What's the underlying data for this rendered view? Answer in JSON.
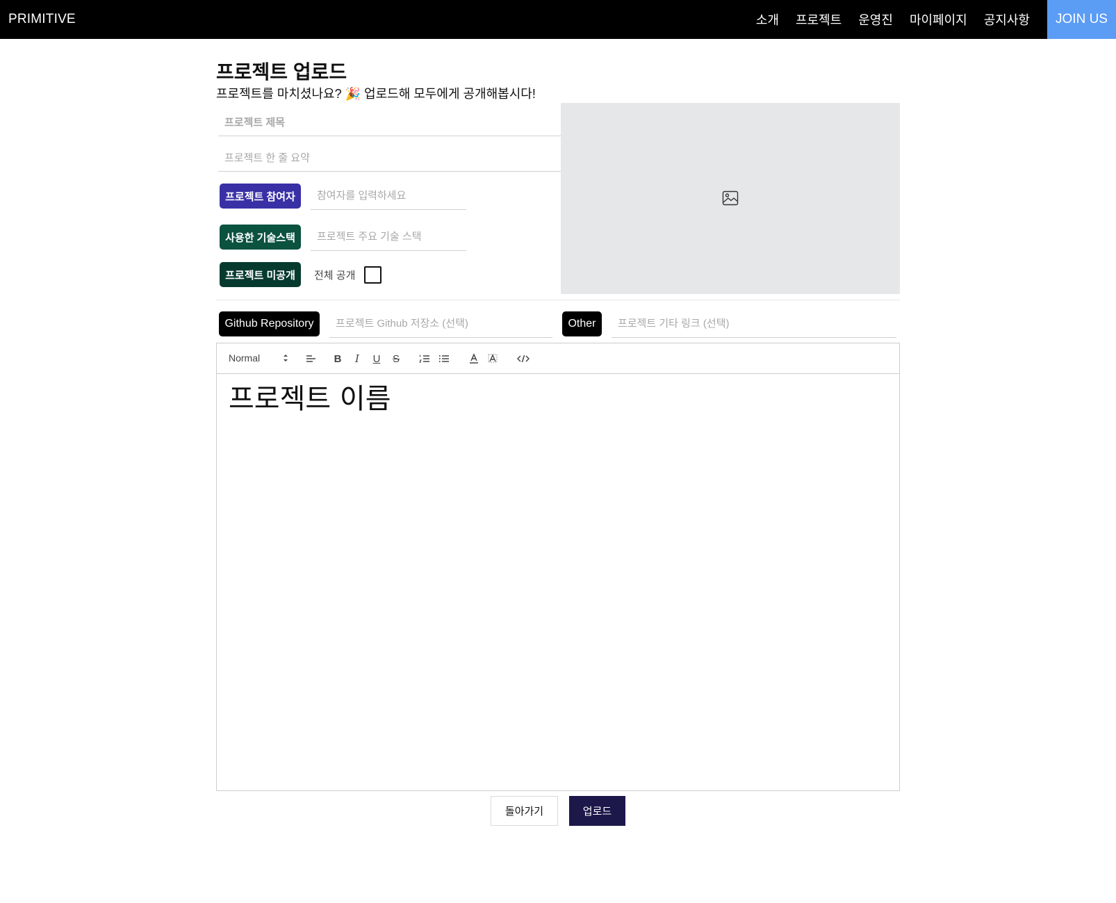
{
  "navbar": {
    "brand": "PRIMITIVE",
    "links": [
      "소개",
      "프로젝트",
      "운영진",
      "마이페이지",
      "공지사항"
    ],
    "join": "JOIN US"
  },
  "header": {
    "title": "프로젝트 업로드",
    "subtitle": "프로젝트를 마치셨나요? 🎉 업로드해 모두에게 공개해봅시다!"
  },
  "form": {
    "title_placeholder": "프로젝트 제목",
    "summary_placeholder": "프로젝트 한 줄 요약",
    "participants_label": "프로젝트 참여자",
    "participants_placeholder": "참여자를 입력하세요",
    "stack_label": "사용한 기술스택",
    "stack_placeholder": "프로젝트 주요 기술 스택",
    "private_label": "프로젝트 미공개",
    "public_label": "전체 공개",
    "public_checked": false,
    "github_label": "Github Repository",
    "github_placeholder": "프로젝트 Github 저장소 (선택)",
    "other_label": "Other",
    "other_placeholder": "프로젝트 기타 링크 (선택)",
    "image_icon": "image-icon"
  },
  "editor": {
    "format": "Normal",
    "content_heading": "프로젝트 이름",
    "tools": [
      "align-icon",
      "bold-icon",
      "italic-icon",
      "underline-icon",
      "strike-icon",
      "ordered-list-icon",
      "bullet-list-icon",
      "text-color-icon",
      "background-color-icon",
      "code-block-icon"
    ]
  },
  "actions": {
    "back": "돌아가기",
    "upload": "업로드"
  },
  "colors": {
    "navbar": "#000000",
    "join": "#5b9cf5",
    "participant_tag": "#3930a6",
    "stack_tag": "#0b523f",
    "private_tag": "#063a2f",
    "upload_button": "#1c1849",
    "image_placeholder": "#e6e7e9"
  }
}
